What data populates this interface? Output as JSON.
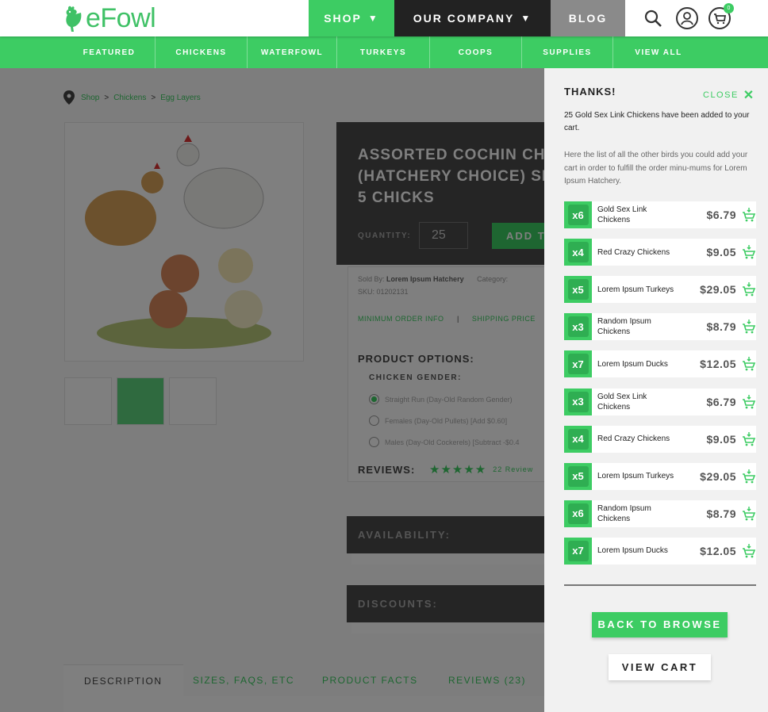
{
  "brand": {
    "logo_text": "eFowl",
    "accent": "#3dcc63"
  },
  "header": {
    "nav": [
      {
        "label": "SHOP"
      },
      {
        "label": "OUR COMPANY"
      },
      {
        "label": "BLOG"
      }
    ],
    "cart_count": "0"
  },
  "subnav": [
    "FEATURED",
    "CHICKENS",
    "WATERFOWL",
    "TURKEYS",
    "COOPS",
    "SUPPLIES",
    "VIEW ALL"
  ],
  "breadcrumb": [
    "Shop",
    "Chickens",
    "Egg Layers"
  ],
  "product": {
    "title": "ASSORTED COCHIN CH\n(HATCHERY CHOICE) SE\n5 CHICKS",
    "quantity_label": "QUANTITY:",
    "quantity_value": "25",
    "add_label": "ADD T",
    "sold_by_label": "Sold By:",
    "sold_by": "Lorem Ipsum Hatchery",
    "category_label": "Category:",
    "sku": "SKU: 01202131",
    "min_order": "MINIMUM ORDER INFO",
    "link_sep": "|",
    "shipping": "SHIPPING PRICE",
    "options_title": "PRODUCT OPTIONS:",
    "gender_title": "CHICKEN GENDER:",
    "gender_options": [
      "Straight Run (Day-Old Random Gender)",
      "Females (Day-Old Pullets) [Add $0.60]",
      "Males (Day-Old Cockerels) [Subtract -$0.4"
    ],
    "reviews_title": "REVIEWS:",
    "stars": "★★★★★",
    "reviews_count": "22 Review",
    "availability": "AVAILABILITY:",
    "discounts": "DISCOUNTS:"
  },
  "tabs": [
    "DESCRIPTION",
    "SIZES, FAQS, ETC",
    "PRODUCT FACTS",
    "REVIEWS (23)"
  ],
  "panel": {
    "thanks": "THANKS!",
    "close": "CLOSE",
    "added_msg": "25 Gold Sex Link Chickens have been added to your cart.",
    "list_msg": "Here the list of all the other birds you could add your cart in order to fulfill the order minu-mums for Lorem Ipsum Hatchery.",
    "items": [
      {
        "qty": "x6",
        "name": "Gold Sex Link Chickens",
        "price": "$6.79"
      },
      {
        "qty": "x4",
        "name": "Red Crazy Chickens",
        "price": "$9.05"
      },
      {
        "qty": "x5",
        "name": "Lorem Ipsum Turkeys",
        "price": "$29.05"
      },
      {
        "qty": "x3",
        "name": "Random Ipsum Chickens",
        "price": "$8.79"
      },
      {
        "qty": "x7",
        "name": "Lorem Ipsum Ducks",
        "price": "$12.05"
      },
      {
        "qty": "x3",
        "name": "Gold Sex Link Chickens",
        "price": "$6.79"
      },
      {
        "qty": "x4",
        "name": "Red Crazy Chickens",
        "price": "$9.05"
      },
      {
        "qty": "x5",
        "name": "Lorem Ipsum Turkeys",
        "price": "$29.05"
      },
      {
        "qty": "x6",
        "name": "Random Ipsum Chickens",
        "price": "$8.79"
      },
      {
        "qty": "x7",
        "name": "Lorem Ipsum Ducks",
        "price": "$12.05"
      }
    ],
    "back_label": "BACK TO BROWSE",
    "view_cart_label": "VIEW CART"
  }
}
